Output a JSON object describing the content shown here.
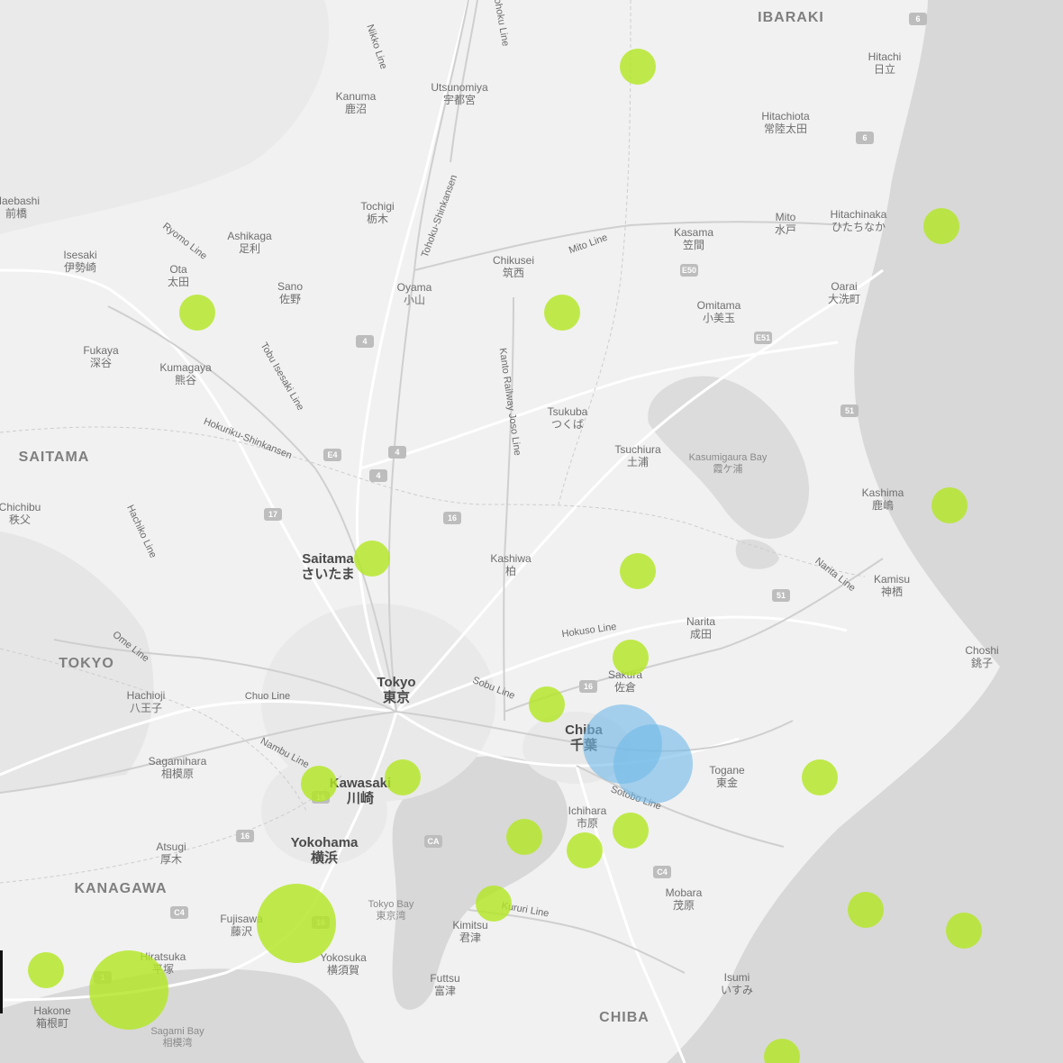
{
  "map": {
    "regions": [
      "IBARAKI",
      "SAITAMA",
      "TOKYO",
      "KANAGAWA",
      "CHIBA"
    ],
    "cities": [
      {
        "en": "Utsunomiya",
        "jp": "宇都宮",
        "major": false
      },
      {
        "en": "Kanuma",
        "jp": "鹿沼",
        "major": false
      },
      {
        "en": "Hitachi",
        "jp": "日立",
        "major": false
      },
      {
        "en": "Hitachiota",
        "jp": "常陸太田",
        "major": false
      },
      {
        "en": "Hitachinaka",
        "jp": "ひたちなか",
        "major": false
      },
      {
        "en": "Mito",
        "jp": "水戸",
        "major": false
      },
      {
        "en": "Kasama",
        "jp": "笠間",
        "major": false
      },
      {
        "en": "Oarai",
        "jp": "大洗町",
        "major": false
      },
      {
        "en": "Omitama",
        "jp": "小美玉",
        "major": false
      },
      {
        "en": "Tochigi",
        "jp": "栃木",
        "major": false
      },
      {
        "en": "Ashikaga",
        "jp": "足利",
        "major": false
      },
      {
        "en": "Isesaki",
        "jp": "伊勢崎",
        "major": false
      },
      {
        "en": "Ota",
        "jp": "太田",
        "major": false
      },
      {
        "en": "Sano",
        "jp": "佐野",
        "major": false
      },
      {
        "en": "Oyama",
        "jp": "小山",
        "major": false
      },
      {
        "en": "Chikusei",
        "jp": "筑西",
        "major": false
      },
      {
        "en": "Fukaya",
        "jp": "深谷",
        "major": false
      },
      {
        "en": "Kumagaya",
        "jp": "熊谷",
        "major": false
      },
      {
        "en": "Tsukuba",
        "jp": "つくば",
        "major": false
      },
      {
        "en": "Tsuchiura",
        "jp": "土浦",
        "major": false
      },
      {
        "en": "Kashima",
        "jp": "鹿嶋",
        "major": false
      },
      {
        "en": "Saitama",
        "jp": "さいたま",
        "major": true
      },
      {
        "en": "Kashiwa",
        "jp": "柏",
        "major": false
      },
      {
        "en": "Kamisu",
        "jp": "神栖",
        "major": false
      },
      {
        "en": "Narita",
        "jp": "成田",
        "major": false
      },
      {
        "en": "Choshi",
        "jp": "銚子",
        "major": false
      },
      {
        "en": "Sakura",
        "jp": "佐倉",
        "major": false
      },
      {
        "en": "Hachioji",
        "jp": "八王子",
        "major": false
      },
      {
        "en": "Tokyo",
        "jp": "東京",
        "major": true
      },
      {
        "en": "Chiba",
        "jp": "千葉",
        "major": true
      },
      {
        "en": "Sagamihara",
        "jp": "相模原",
        "major": false
      },
      {
        "en": "Kawasaki",
        "jp": "川崎",
        "major": true
      },
      {
        "en": "Togane",
        "jp": "東金",
        "major": false
      },
      {
        "en": "Ichihara",
        "jp": "市原",
        "major": false
      },
      {
        "en": "Atsugi",
        "jp": "厚木",
        "major": false
      },
      {
        "en": "Yokohama",
        "jp": "横浜",
        "major": true
      },
      {
        "en": "Mobara",
        "jp": "茂原",
        "major": false
      },
      {
        "en": "Fujisawa",
        "jp": "藤沢",
        "major": false
      },
      {
        "en": "Kimitsu",
        "jp": "君津",
        "major": false
      },
      {
        "en": "Hiratsuka",
        "jp": "平塚",
        "major": false
      },
      {
        "en": "Yokosuka",
        "jp": "横須賀",
        "major": false
      },
      {
        "en": "Futtsu",
        "jp": "富津",
        "major": false
      },
      {
        "en": "Isumi",
        "jp": "いすみ",
        "major": false
      },
      {
        "en": "Hakone",
        "jp": "箱根町",
        "major": false
      },
      {
        "en": "Chichibu",
        "jp": "秩父",
        "major": false
      },
      {
        "en": "Maebashi",
        "jp": "前橋",
        "major": false
      }
    ],
    "water": [
      {
        "en": "Kasumigaura Bay",
        "jp": "霞ケ浦"
      },
      {
        "en": "Tokyo Bay",
        "jp": "東京湾"
      },
      {
        "en": "Sagami Bay",
        "jp": "相模湾"
      }
    ],
    "lines": [
      "Nikko Line",
      "Tohoku Line",
      "Tohoku-Shinkansen",
      "Ryomo Line",
      "Mito Line",
      "Tobu Isesaki Line",
      "Kanto Railway Joso Line",
      "Hokuriku-Shinkansen",
      "Hachiko Line",
      "Ome Line",
      "Chuo Line",
      "Nambu Line",
      "Sobu Line",
      "Hokuso Line",
      "Narita Line",
      "Sotobo Line",
      "Kururi Line"
    ],
    "route_shields": [
      "6",
      "6",
      "E50",
      "4",
      "E51",
      "51",
      "E4",
      "4",
      "4",
      "16",
      "17",
      "51",
      "16",
      "16",
      "C4",
      "CA",
      "16",
      "C4",
      "1",
      "16"
    ],
    "markers": [
      {
        "lng": 139.82,
        "lat": 36.64,
        "size": 1,
        "color": "green"
      },
      {
        "lng": 140.22,
        "lat": 36.4,
        "size": 1,
        "color": "green"
      },
      {
        "lng": 139.24,
        "lat": 36.27,
        "size": 1,
        "color": "green"
      },
      {
        "lng": 139.72,
        "lat": 36.27,
        "size": 1,
        "color": "green"
      },
      {
        "lng": 140.41,
        "lat": 36.12,
        "size": 1,
        "color": "green"
      },
      {
        "lng": 140.59,
        "lat": 36.15,
        "size": 1,
        "color": "green"
      },
      {
        "lng": 140.62,
        "lat": 36.03,
        "size": 1,
        "color": "green"
      },
      {
        "lng": 140.23,
        "lat": 35.98,
        "size": 1,
        "color": "green"
      },
      {
        "lng": 139.47,
        "lat": 35.9,
        "size": 1,
        "color": "green"
      },
      {
        "lng": 139.82,
        "lat": 35.88,
        "size": 1,
        "color": "green"
      },
      {
        "lng": 140.41,
        "lat": 35.86,
        "size": 1,
        "color": "green"
      },
      {
        "lng": 139.81,
        "lat": 35.75,
        "size": 1,
        "color": "green"
      },
      {
        "lng": 140.51,
        "lat": 35.73,
        "size": 1,
        "color": "green"
      },
      {
        "lng": 139.7,
        "lat": 35.68,
        "size": 1,
        "color": "green"
      },
      {
        "lng": 139.4,
        "lat": 35.56,
        "size": 1,
        "color": "green"
      },
      {
        "lng": 139.51,
        "lat": 35.57,
        "size": 1,
        "color": "green"
      },
      {
        "lng": 140.06,
        "lat": 35.57,
        "size": 1,
        "color": "green"
      },
      {
        "lng": 140.45,
        "lat": 35.56,
        "size": 1,
        "color": "green"
      },
      {
        "lng": 139.67,
        "lat": 35.48,
        "size": 1,
        "color": "green"
      },
      {
        "lng": 139.81,
        "lat": 35.49,
        "size": 1,
        "color": "green"
      },
      {
        "lng": 139.75,
        "lat": 35.46,
        "size": 1,
        "color": "green"
      },
      {
        "lng": 139.63,
        "lat": 35.38,
        "size": 1,
        "color": "green"
      },
      {
        "lng": 140.12,
        "lat": 35.37,
        "size": 1,
        "color": "green"
      },
      {
        "lng": 139.37,
        "lat": 35.35,
        "size": 2,
        "color": "green"
      },
      {
        "lng": 140.25,
        "lat": 35.34,
        "size": 1,
        "color": "green"
      },
      {
        "lng": 139.04,
        "lat": 35.28,
        "size": 1,
        "color": "green"
      },
      {
        "lng": 139.15,
        "lat": 35.25,
        "size": 2,
        "color": "green"
      },
      {
        "lng": 140.01,
        "lat": 35.15,
        "size": 1,
        "color": "green"
      },
      {
        "lng": 139.8,
        "lat": 35.62,
        "size": 2,
        "color": "blue"
      },
      {
        "lng": 139.84,
        "lat": 35.59,
        "size": 2,
        "color": "blue"
      }
    ]
  }
}
